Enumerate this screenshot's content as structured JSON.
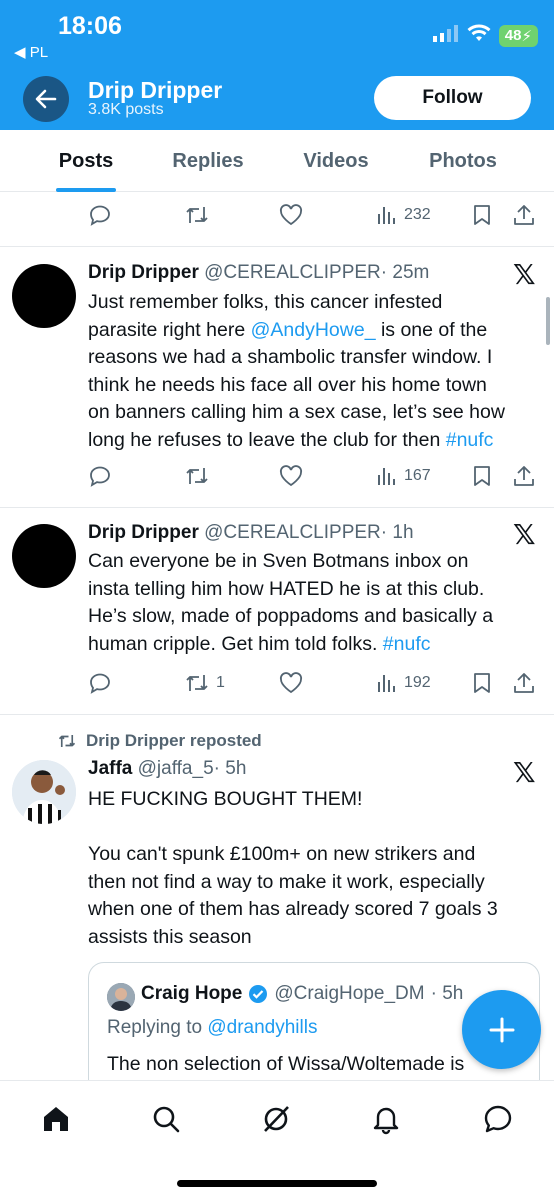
{
  "status_bar": {
    "time": "18:06",
    "back_app": "◀ PL",
    "battery": "48"
  },
  "header": {
    "name": "Drip Dripper",
    "posts": "3.8K posts",
    "follow_label": "Follow"
  },
  "tabs": [
    "Posts",
    "Replies",
    "Videos",
    "Photos"
  ],
  "active_tab": "Posts",
  "top_actions": {
    "views": "232"
  },
  "posts": [
    {
      "name": "Drip Dripper",
      "handle": "@CEREALCLIPPER",
      "time": "· 25m",
      "lines": [
        "Just remember folks, this cancer infested",
        "parasite right here ",
        "@AndyHowe_",
        " is one of the",
        "reasons we had a shambolic transfer window. I",
        "think he needs his face all over his home town",
        "on banners calling him a sex case, let’s see how",
        "long he refuses to leave the club for then ",
        "#nufc"
      ],
      "reposts": "",
      "views": "167"
    },
    {
      "name": "Drip Dripper",
      "handle": "@CEREALCLIPPER",
      "time": "· 1h",
      "lines": [
        "Can everyone be in Sven Botmans inbox on",
        "insta telling him how HATED he is at this club.",
        "He’s slow, made of poppadoms and basically a",
        "human cripple. Get him told folks. ",
        "#nufc"
      ],
      "reposts": "1",
      "views": "192"
    }
  ],
  "repost": {
    "label": "Drip Dripper reposted",
    "name": "Jaffa",
    "handle": "@jaffa_5",
    "time": "· 5h",
    "lines": [
      "HE FUCKING BOUGHT THEM!",
      "You can't spunk £100m+ on new strikers and",
      "then not find a way to make it work, especially",
      "when one of them has already scored 7 goals 3",
      "assists this season"
    ],
    "quote": {
      "name": "Craig Hope",
      "handle": "@CraigHope_DM",
      "time": "· 5h",
      "replying_prefix": "Replying to ",
      "replying_to": "@drandyhills",
      "text": "The non selection of Wissa/Woltemade is"
    }
  },
  "colors": {
    "brand": "#1d9bf0",
    "text": "#0f1419",
    "muted": "#536471"
  },
  "icons": [
    "back-arrow-icon",
    "wifi-icon",
    "signal-icon",
    "reply-icon",
    "repost-icon",
    "like-icon",
    "views-icon",
    "bookmark-icon",
    "share-icon",
    "x-logo-icon",
    "verified-icon",
    "compose-icon",
    "home-icon",
    "search-icon",
    "grok-icon",
    "notifications-icon",
    "messages-icon"
  ]
}
